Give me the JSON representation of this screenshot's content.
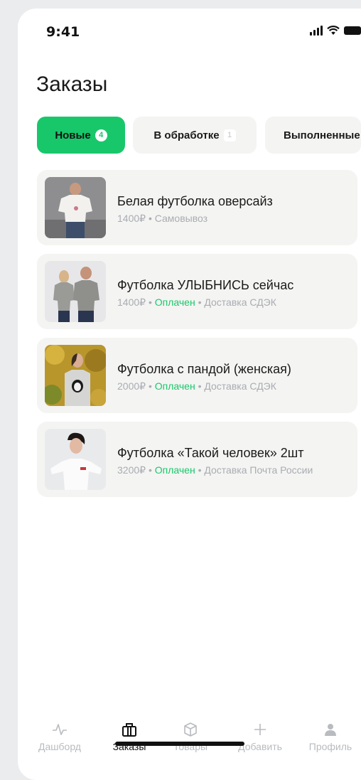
{
  "status_bar": {
    "time": "9:41"
  },
  "page": {
    "title": "Заказы"
  },
  "tabs": [
    {
      "label": "Новые",
      "badge": "4",
      "active": true
    },
    {
      "label": "В обработке",
      "badge": "1",
      "active": false
    },
    {
      "label": "Выполненные",
      "active": false
    }
  ],
  "orders": [
    {
      "title": "Белая футболка оверсайз",
      "price": "1400₽",
      "sep1": " • ",
      "delivery": "Самовывоз"
    },
    {
      "title": "Футболка УЛЫБНИСЬ сейчас",
      "price": "1400₽",
      "sep1": " • ",
      "status": "Оплачен",
      "sep2": " • ",
      "delivery": "Доставка СДЭК"
    },
    {
      "title": "Футболка с пандой (женская)",
      "price": "2000₽",
      "sep1": " • ",
      "status": "Оплачен",
      "sep2": " • ",
      "delivery": "Доставка СДЭК"
    },
    {
      "title": "Футболка «Такой человек» 2шт",
      "price": "3200₽",
      "sep1": " • ",
      "status": "Оплачен",
      "sep2": " • ",
      "delivery": "Доставка Почта России"
    }
  ],
  "nav": [
    {
      "label": "Дашборд",
      "icon": "activity-icon",
      "active": false
    },
    {
      "label": "Заказы",
      "icon": "shopping-bag-icon",
      "active": true
    },
    {
      "label": "Товары",
      "icon": "box-icon",
      "active": false
    },
    {
      "label": "Добавить",
      "icon": "plus-icon",
      "active": false
    },
    {
      "label": "Профиль",
      "icon": "user-icon",
      "active": false
    }
  ],
  "colors": {
    "accent": "#19c76b",
    "card": "#f4f4f2",
    "muted": "#a9acb3"
  }
}
